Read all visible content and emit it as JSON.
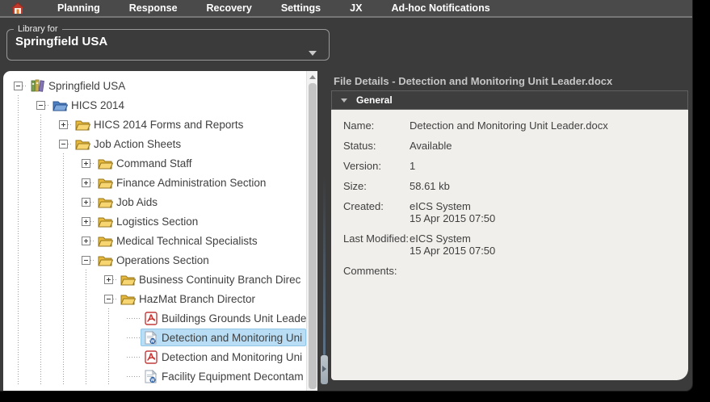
{
  "navbar": {
    "home_icon": "home-icon",
    "items": [
      {
        "label": "Planning"
      },
      {
        "label": "Response"
      },
      {
        "label": "Recovery"
      },
      {
        "label": "Settings"
      },
      {
        "label": "JX"
      },
      {
        "label": "Ad-hoc Notifications"
      }
    ]
  },
  "library_selector": {
    "label": "Library for",
    "value": "Springfield USA",
    "caret_icon": "chevron-down-icon"
  },
  "tree": {
    "items": [
      {
        "label": "Springfield USA",
        "level": 0,
        "expander": "minus",
        "icon": "library",
        "selected": false
      },
      {
        "label": "HICS 2014",
        "level": 1,
        "expander": "minus",
        "icon": "folder-blue",
        "selected": false
      },
      {
        "label": "HICS 2014 Forms and Reports",
        "level": 2,
        "expander": "plus",
        "icon": "folder",
        "selected": false
      },
      {
        "label": "Job Action Sheets",
        "level": 2,
        "expander": "minus",
        "icon": "folder",
        "selected": false
      },
      {
        "label": "Command Staff",
        "level": 3,
        "expander": "plus",
        "icon": "folder",
        "selected": false
      },
      {
        "label": "Finance Administration Section",
        "level": 3,
        "expander": "plus",
        "icon": "folder",
        "selected": false
      },
      {
        "label": "Job Aids",
        "level": 3,
        "expander": "plus",
        "icon": "folder",
        "selected": false
      },
      {
        "label": "Logistics Section",
        "level": 3,
        "expander": "plus",
        "icon": "folder",
        "selected": false
      },
      {
        "label": "Medical Technical Specialists",
        "level": 3,
        "expander": "plus",
        "icon": "folder",
        "selected": false
      },
      {
        "label": "Operations Section",
        "level": 3,
        "expander": "minus",
        "icon": "folder",
        "selected": false
      },
      {
        "label": "Business Continuity Branch Direc",
        "level": 4,
        "expander": "plus",
        "icon": "folder",
        "selected": false
      },
      {
        "label": "HazMat Branch Director",
        "level": 4,
        "expander": "minus",
        "icon": "folder",
        "selected": false
      },
      {
        "label": "Buildings Grounds Unit Leade",
        "level": 5,
        "expander": "none",
        "icon": "pdf",
        "selected": false
      },
      {
        "label": "Detection and Monitoring Uni",
        "level": 5,
        "expander": "none",
        "icon": "word",
        "selected": true
      },
      {
        "label": "Detection and Monitoring Uni",
        "level": 5,
        "expander": "none",
        "icon": "pdf",
        "selected": false
      },
      {
        "label": "Facility Equipment Decontam",
        "level": 5,
        "expander": "none",
        "icon": "word",
        "selected": false
      }
    ]
  },
  "details": {
    "title": "File Details - Detection and Monitoring Unit Leader.docx",
    "section_label": "General",
    "section_caret_icon": "chevron-down-icon",
    "fields": [
      {
        "label": "Name:",
        "values": [
          "Detection and Monitoring Unit Leader.docx"
        ]
      },
      {
        "label": "Status:",
        "values": [
          "Available"
        ]
      },
      {
        "label": "Version:",
        "values": [
          "1"
        ]
      },
      {
        "label": "Size:",
        "values": [
          "58.61 kb"
        ]
      },
      {
        "label": "Created:",
        "values": [
          "eICS System",
          "15 Apr 2015 07:50"
        ]
      },
      {
        "label": "Last Modified:",
        "values": [
          "eICS System",
          "15 Apr 2015 07:50"
        ]
      },
      {
        "label": "Comments:",
        "values": []
      }
    ]
  },
  "colors": {
    "navbar_bg": "#4a4a4a",
    "body_bg": "#3b3b3b",
    "tree_bg": "#ffffff",
    "selection_bg": "#b9ddf4",
    "selection_border": "#93c7e8",
    "details_body_bg": "#f0efeb",
    "section_header_bg": "#3e3e3e",
    "folder_yellow": "#f2c14e",
    "folder_blue": "#6d9bd3",
    "pdf_red": "#cc2b2b",
    "word_blue": "#2a5fa5"
  }
}
